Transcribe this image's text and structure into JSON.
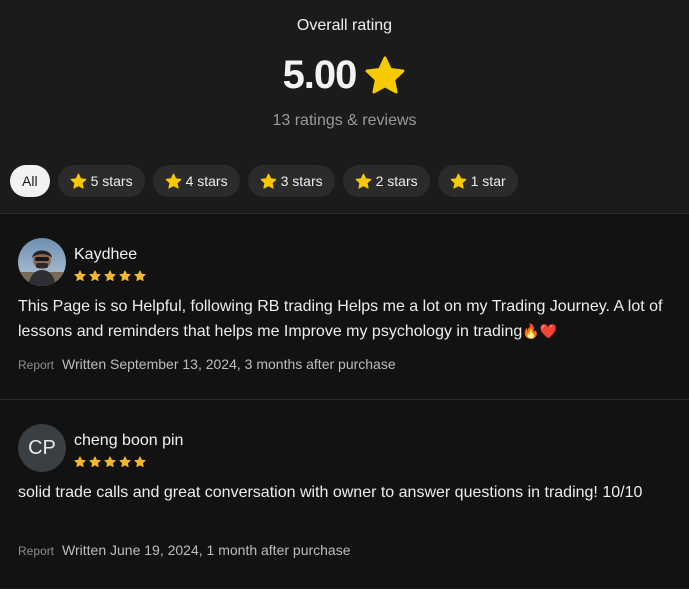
{
  "summary": {
    "title": "Overall rating",
    "score": "5.00",
    "count_text": "13 ratings & reviews"
  },
  "filters": [
    {
      "label": "All",
      "active": true
    },
    {
      "label": "5 stars",
      "icon": "star-icon"
    },
    {
      "label": "4 stars",
      "icon": "star-icon"
    },
    {
      "label": "3 stars",
      "icon": "star-icon"
    },
    {
      "label": "2 stars",
      "icon": "star-icon"
    },
    {
      "label": "1 star",
      "icon": "star-icon"
    }
  ],
  "reviews": [
    {
      "name": "Kaydhee",
      "rating": 5,
      "text": "This Page is so Helpful, following RB trading Helps me a lot on my Trading Journey. A lot of lessons and reminders that helps me Improve my psychology in trading",
      "emojis": "🔥❤️",
      "report_label": "Report",
      "written": "Written September 13, 2024, 3 months after purchase"
    },
    {
      "name": "cheng boon pin",
      "initials": "CP",
      "rating": 5,
      "text": "solid trade calls and great conversation with owner to answer questions in trading! 10/10",
      "report_label": "Report",
      "written": "Written June 19, 2024, 1 month after purchase"
    }
  ],
  "colors": {
    "star": "#f7c900",
    "star_small": "#f5b72d",
    "background": "#1b1b1b",
    "list_background": "#121212",
    "chip_background": "#2b2b2b"
  }
}
